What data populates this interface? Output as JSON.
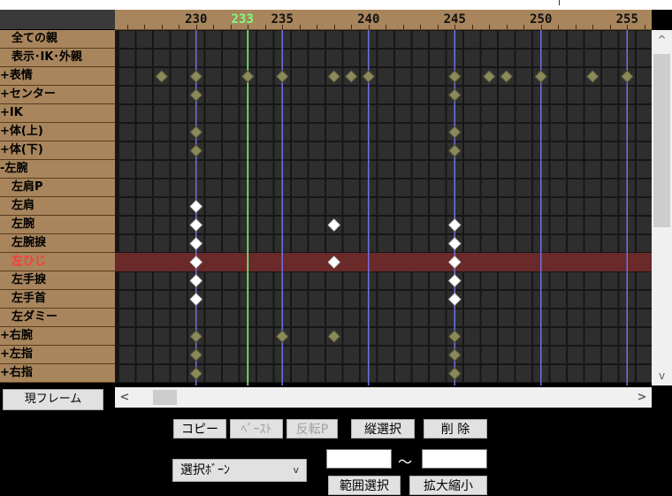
{
  "ruler": {
    "labels": [
      {
        "text": "230",
        "frame": 230,
        "current": false
      },
      {
        "text": "233",
        "frame": 233,
        "current": true
      },
      {
        "text": "235",
        "frame": 235,
        "current": false
      },
      {
        "text": "240",
        "frame": 240,
        "current": false
      },
      {
        "text": "245",
        "frame": 245,
        "current": false
      },
      {
        "text": "250",
        "frame": 250,
        "current": false
      },
      {
        "text": "255",
        "frame": 255,
        "current": false
      }
    ]
  },
  "timeline": {
    "first_frame": 226,
    "visible_frames": 31,
    "current_frame": 233
  },
  "bones": [
    {
      "label": "全ての親",
      "indent": true,
      "selected": false,
      "keys": []
    },
    {
      "label": "表示･IK･外親",
      "indent": true,
      "selected": false,
      "keys": []
    },
    {
      "label": "+表情",
      "indent": false,
      "selected": false,
      "keys": [
        {
          "f": 228,
          "s": false
        },
        {
          "f": 230,
          "s": false
        },
        {
          "f": 233,
          "s": false
        },
        {
          "f": 235,
          "s": false
        },
        {
          "f": 238,
          "s": false
        },
        {
          "f": 239,
          "s": false
        },
        {
          "f": 240,
          "s": false
        },
        {
          "f": 245,
          "s": false
        },
        {
          "f": 247,
          "s": false
        },
        {
          "f": 248,
          "s": false
        },
        {
          "f": 250,
          "s": false
        },
        {
          "f": 253,
          "s": false
        },
        {
          "f": 255,
          "s": false
        }
      ]
    },
    {
      "label": "+センター",
      "indent": false,
      "selected": false,
      "keys": [
        {
          "f": 230,
          "s": false
        },
        {
          "f": 245,
          "s": false
        }
      ]
    },
    {
      "label": "+IK",
      "indent": false,
      "selected": false,
      "keys": []
    },
    {
      "label": "+体(上)",
      "indent": false,
      "selected": false,
      "keys": [
        {
          "f": 230,
          "s": false
        },
        {
          "f": 245,
          "s": false
        }
      ]
    },
    {
      "label": "+体(下)",
      "indent": false,
      "selected": false,
      "keys": [
        {
          "f": 230,
          "s": false
        },
        {
          "f": 245,
          "s": false
        }
      ]
    },
    {
      "label": "-左腕",
      "indent": false,
      "selected": false,
      "keys": []
    },
    {
      "label": "左肩P",
      "indent": true,
      "selected": false,
      "keys": []
    },
    {
      "label": "左肩",
      "indent": true,
      "selected": false,
      "keys": [
        {
          "f": 230,
          "s": true
        }
      ]
    },
    {
      "label": "左腕",
      "indent": true,
      "selected": false,
      "keys": [
        {
          "f": 230,
          "s": true
        },
        {
          "f": 238,
          "s": true
        },
        {
          "f": 245,
          "s": true
        }
      ]
    },
    {
      "label": "左腕捩",
      "indent": true,
      "selected": false,
      "keys": [
        {
          "f": 230,
          "s": true
        },
        {
          "f": 245,
          "s": true
        }
      ]
    },
    {
      "label": "左ひじ",
      "indent": true,
      "selected": true,
      "keys": [
        {
          "f": 230,
          "s": true
        },
        {
          "f": 238,
          "s": true
        },
        {
          "f": 245,
          "s": true
        }
      ]
    },
    {
      "label": "左手捩",
      "indent": true,
      "selected": false,
      "keys": [
        {
          "f": 230,
          "s": true
        },
        {
          "f": 245,
          "s": true
        }
      ]
    },
    {
      "label": "左手首",
      "indent": true,
      "selected": false,
      "keys": [
        {
          "f": 230,
          "s": true
        },
        {
          "f": 245,
          "s": true
        }
      ]
    },
    {
      "label": "左ダミー",
      "indent": true,
      "selected": false,
      "keys": []
    },
    {
      "label": "+右腕",
      "indent": false,
      "selected": false,
      "keys": [
        {
          "f": 230,
          "s": false
        },
        {
          "f": 235,
          "s": false
        },
        {
          "f": 238,
          "s": false
        },
        {
          "f": 245,
          "s": false
        }
      ]
    },
    {
      "label": "+左指",
      "indent": false,
      "selected": false,
      "keys": [
        {
          "f": 230,
          "s": false
        },
        {
          "f": 245,
          "s": false
        }
      ]
    },
    {
      "label": "+右指",
      "indent": false,
      "selected": false,
      "keys": [
        {
          "f": 230,
          "s": false
        },
        {
          "f": 245,
          "s": false
        }
      ]
    }
  ],
  "controls": {
    "current_frame_button": "現フレーム",
    "copy": "コピー",
    "paste": "ﾍﾟｰｽﾄ",
    "reverse_paste": "反転P",
    "vertical_select": "縦選択",
    "delete": "削 除",
    "bone_select": "選択ﾎﾞｰﾝ",
    "range_from": "",
    "range_to": "",
    "tilde": "～",
    "range_select": "範囲選択",
    "scale": "拡大縮小"
  },
  "colors": {
    "bone_label_bg": "#a8855c",
    "row_light": "#2e2e2e",
    "row_dark": "#161616",
    "row_selected": "#6a2a2a",
    "current_frame_line": "#7dff7d",
    "major_line": "#7070e0",
    "key_selected": "#ffffff",
    "key_unselected": "#8a8a5a"
  }
}
